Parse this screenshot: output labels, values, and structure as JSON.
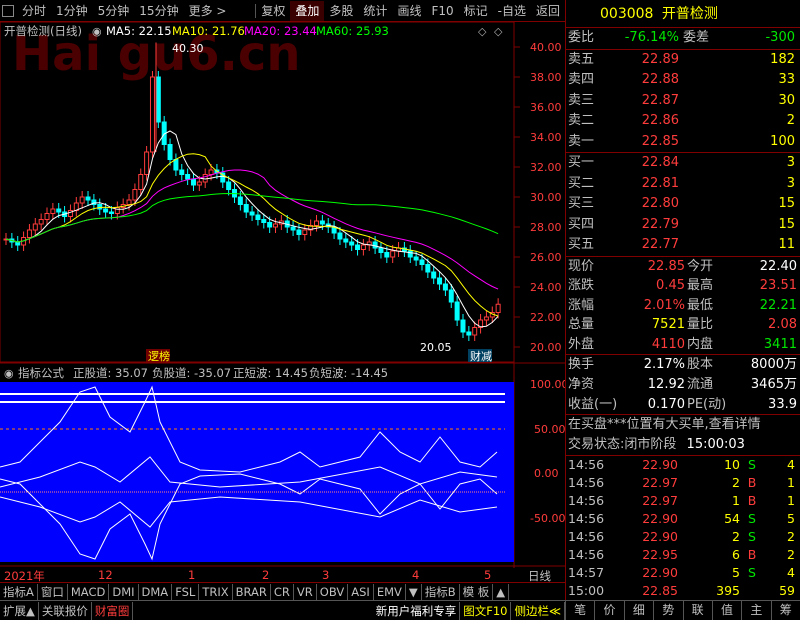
{
  "toolbar": {
    "items": [
      "分时",
      "1分钟",
      "5分钟",
      "15分钟",
      "更多 >"
    ],
    "items_right": [
      "复权",
      "叠加",
      "多股",
      "统计",
      "画线",
      "F10",
      "标记",
      "-自选",
      "返回"
    ],
    "active": "叠加"
  },
  "stock": {
    "code": "003008",
    "name": "开普检测"
  },
  "kline_legend": {
    "title": "开普检测(日线)",
    "ma5": "MA5: 22.15",
    "ma10": "MA10: 21.76",
    "ma20": "MA20: 23.44",
    "ma60": "MA60: 25.93",
    "colors": {
      "ma5": "#ffffff",
      "ma10": "#ffff00",
      "ma20": "#ff00ff",
      "ma60": "#00ff00"
    }
  },
  "watermark": "Hai   gu6.cn",
  "annotations": {
    "high": "40.30",
    "low": "20.05",
    "tag1": "逻榜",
    "tag2": "财减"
  },
  "price_axis": [
    "40.00",
    "38.00",
    "36.00",
    "34.00",
    "32.00",
    "30.00",
    "28.00",
    "26.00",
    "24.00",
    "22.00",
    "20.00"
  ],
  "indicator_legend": {
    "title": "指标公式",
    "l1": "正股道: 35.07",
    "l2": "负股道: -35.07",
    "l3": "正短波: 14.45",
    "l4": "负短波: -14.45"
  },
  "indicator_axis": [
    "100.00",
    "50.00",
    "0.00",
    "-50.00"
  ],
  "date_axis": [
    "2021年",
    "12",
    "1",
    "2",
    "3",
    "4",
    "5"
  ],
  "date_axis_right": "日线",
  "bottom_tabs": [
    "指标A",
    "窗口",
    "MACD",
    "DMI",
    "DMA",
    "FSL",
    "TRIX",
    "BRAR",
    "CR",
    "VR",
    "OBV",
    "ASI",
    "EMV",
    "▼",
    "指标B",
    "模 板",
    "▲"
  ],
  "status_bar": [
    "扩展▲",
    "关联报价",
    "财富圈"
  ],
  "status_bar_right": [
    "新用户福利专享",
    "图文F10",
    "侧边栏≪"
  ],
  "right_tabs": [
    "笔",
    "价",
    "细",
    "势",
    "联",
    "值",
    "主",
    "筹"
  ],
  "order_book": {
    "ratio_label": "委比",
    "ratio_val": "-76.14%",
    "diff_label": "委差",
    "diff_val": "-300",
    "sells": [
      {
        "label": "卖五",
        "price": "22.89",
        "vol": "182"
      },
      {
        "label": "卖四",
        "price": "22.88",
        "vol": "33"
      },
      {
        "label": "卖三",
        "price": "22.87",
        "vol": "30"
      },
      {
        "label": "卖二",
        "price": "22.86",
        "vol": "2"
      },
      {
        "label": "卖一",
        "price": "22.85",
        "vol": "100"
      }
    ],
    "buys": [
      {
        "label": "买一",
        "price": "22.84",
        "vol": "3"
      },
      {
        "label": "买二",
        "price": "22.81",
        "vol": "3"
      },
      {
        "label": "买三",
        "price": "22.80",
        "vol": "15"
      },
      {
        "label": "买四",
        "price": "22.79",
        "vol": "15"
      },
      {
        "label": "买五",
        "price": "22.77",
        "vol": "11"
      }
    ]
  },
  "quote": [
    {
      "l1": "现价",
      "v1": "22.85",
      "c1": "red",
      "l2": "今开",
      "v2": "22.40",
      "c2": "white"
    },
    {
      "l1": "涨跌",
      "v1": "0.45",
      "c1": "red",
      "l2": "最高",
      "v2": "23.51",
      "c2": "red"
    },
    {
      "l1": "涨幅",
      "v1": "2.01%",
      "c1": "red",
      "l2": "最低",
      "v2": "22.21",
      "c2": "green"
    },
    {
      "l1": "总量",
      "v1": "7521",
      "c1": "yellow",
      "l2": "量比",
      "v2": "2.08",
      "c2": "red"
    },
    {
      "l1": "外盘",
      "v1": "4110",
      "c1": "red",
      "l2": "内盘",
      "v2": "3411",
      "c2": "green"
    }
  ],
  "fundamentals": [
    {
      "l1": "换手",
      "v1": "2.17%",
      "l2": "股本",
      "v2": "8000万"
    },
    {
      "l1": "净资",
      "v1": "12.92",
      "l2": "流通",
      "v2": "3465万"
    },
    {
      "l1": "收益(一)",
      "v1": "0.170",
      "l2": "PE(动)",
      "v2": "33.9"
    }
  ],
  "notice": "在买盘***位置有大买单,查看详情",
  "trade_status": {
    "label": "交易状态:",
    "value": "闭市阶段",
    "time": "15:00:03"
  },
  "ticks": [
    {
      "t": "14:56",
      "p": "22.90",
      "v": "10",
      "bs": "S",
      "n": "4"
    },
    {
      "t": "14:56",
      "p": "22.97",
      "v": "2",
      "bs": "B",
      "n": "1"
    },
    {
      "t": "14:56",
      "p": "22.97",
      "v": "1",
      "bs": "B",
      "n": "1"
    },
    {
      "t": "14:56",
      "p": "22.90",
      "v": "54",
      "bs": "S",
      "n": "5"
    },
    {
      "t": "14:56",
      "p": "22.90",
      "v": "2",
      "bs": "S",
      "n": "2"
    },
    {
      "t": "14:56",
      "p": "22.95",
      "v": "6",
      "bs": "B",
      "n": "2"
    },
    {
      "t": "14:57",
      "p": "22.90",
      "v": "5",
      "bs": "S",
      "n": "4"
    },
    {
      "t": "15:00",
      "p": "22.85",
      "v": "395",
      "bs": "",
      "n": "59"
    }
  ]
}
